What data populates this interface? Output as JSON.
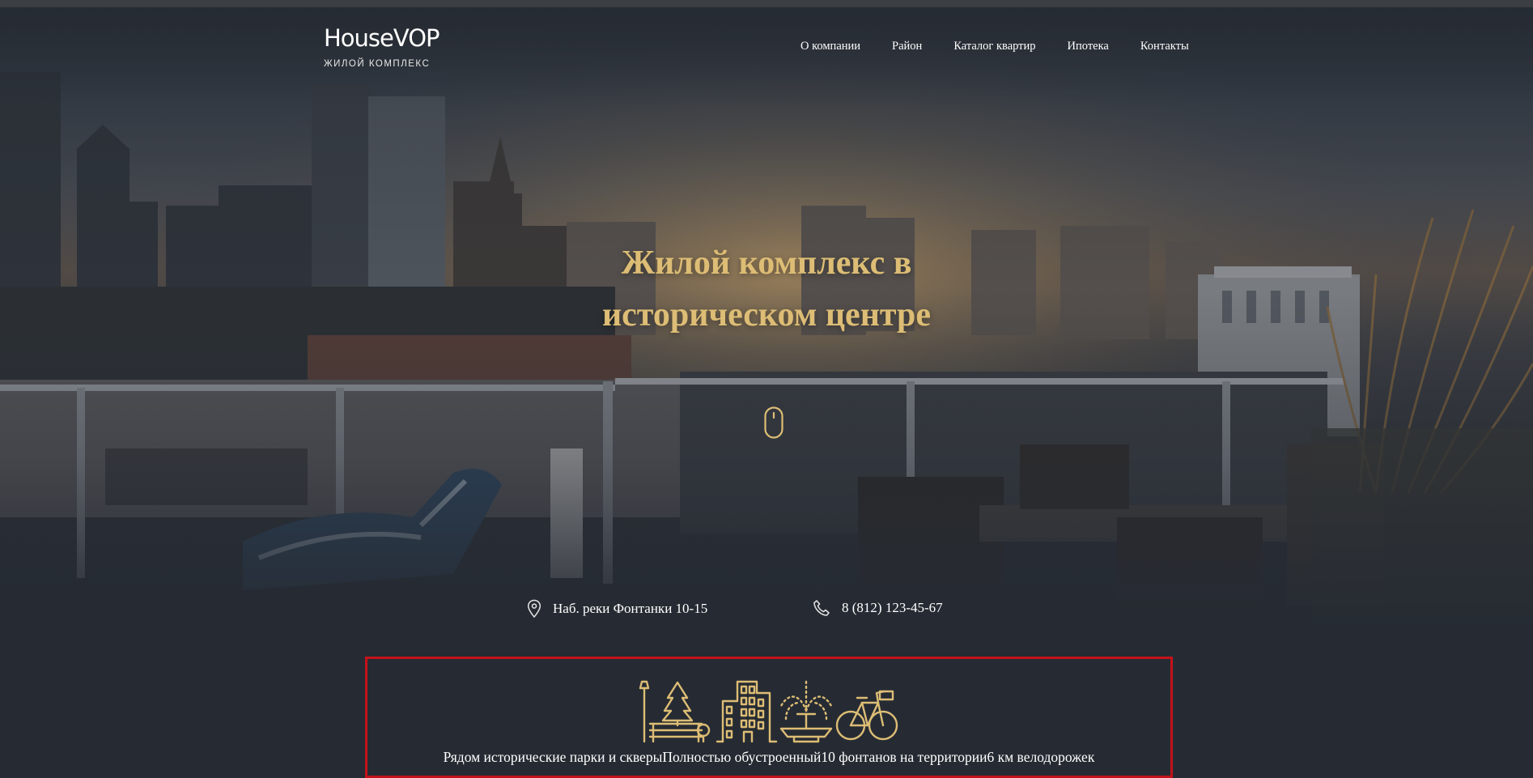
{
  "brand": {
    "name": "HouseVOP",
    "subtitle": "ЖИЛОЙ КОМПЛЕКС"
  },
  "nav": {
    "items": [
      {
        "label": "О компании"
      },
      {
        "label": "Район"
      },
      {
        "label": "Каталог квартир"
      },
      {
        "label": "Ипотека"
      },
      {
        "label": "Контакты"
      }
    ]
  },
  "hero": {
    "title": "Жилой комплекс в историческом центре",
    "scroll_icon": "mouse-icon"
  },
  "contacts": {
    "address": "Наб. реки Фонтанки 10-15",
    "address_icon": "map-pin-icon",
    "phone": "8 (812) 123-45-67",
    "phone_icon": "phone-icon"
  },
  "features": {
    "items": [
      {
        "text": "Рядом исторические парки и скверы"
      },
      {
        "text": "Полностью обустроенный"
      },
      {
        "text": "10 фонтанов на территории"
      },
      {
        "text": "6 км велодорожек"
      }
    ],
    "illustration_icon": "city-amenities-icon"
  },
  "colors": {
    "accent": "#ddbd75",
    "background": "#262b33",
    "highlight_border": "#c4121a"
  }
}
